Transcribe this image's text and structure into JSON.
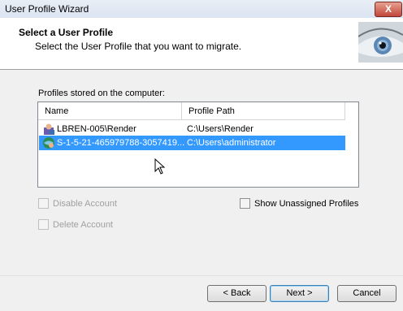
{
  "window": {
    "title": "User Profile Wizard",
    "close_label": "X"
  },
  "header": {
    "title": "Select a User Profile",
    "subtitle": "Select the User Profile that you want to migrate."
  },
  "profiles": {
    "group_label": "Profiles stored on the computer:",
    "columns": [
      "Name",
      "Profile Path"
    ],
    "rows": [
      {
        "name": "LBREN-005\\Render",
        "path": "C:\\Users\\Render",
        "icon": "user-profile-icon",
        "selected": false
      },
      {
        "name": "S-1-5-21-465979788-3057419...",
        "path": "C:\\Users\\administrator",
        "icon": "domain-profile-icon",
        "selected": true
      }
    ]
  },
  "options": {
    "disable_account": "Disable Account",
    "delete_account": "Delete Account",
    "show_unassigned": "Show Unassigned Profiles"
  },
  "buttons": {
    "back": "< Back",
    "next": "Next >",
    "cancel": "Cancel"
  },
  "colors": {
    "selection": "#3399ff",
    "content_bg": "#f0f0f0",
    "close_red": "#c0473a"
  }
}
